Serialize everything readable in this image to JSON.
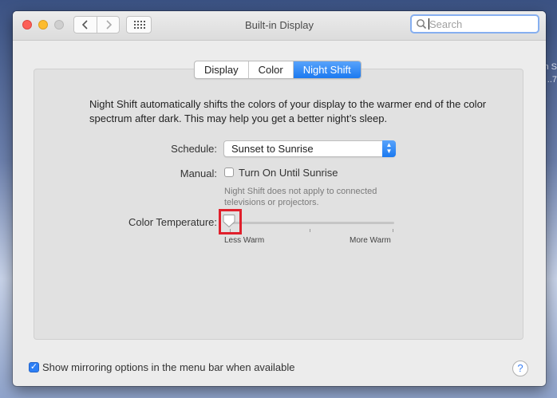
{
  "desktop": {
    "text_1": "n S",
    "text_2": "..7"
  },
  "window": {
    "title": "Built-in Display",
    "search": {
      "placeholder": "Search"
    },
    "tabs": [
      {
        "label": "Display",
        "active": false
      },
      {
        "label": "Color",
        "active": false
      },
      {
        "label": "Night Shift",
        "active": true
      }
    ]
  },
  "night_shift": {
    "description": "Night Shift automatically shifts the colors of your display to the warmer end of the color spectrum after dark. This may help you get a better night’s sleep.",
    "schedule_label": "Schedule:",
    "schedule_value": "Sunset to Sunrise",
    "manual_label": "Manual:",
    "manual_checkbox_label": "Turn On Until Sunrise",
    "manual_checked": false,
    "note": "Night Shift does not apply to connected televisions or projectors.",
    "color_temperature_label": "Color Temperature:",
    "slider_min_label": "Less Warm",
    "slider_max_label": "More Warm",
    "slider_value": 0
  },
  "footer": {
    "mirroring_label": "Show mirroring options in the menu bar when available",
    "mirroring_checked": true,
    "help_label": "?"
  },
  "colors": {
    "accent": "#1b79f0",
    "highlight": "#e0202c"
  }
}
